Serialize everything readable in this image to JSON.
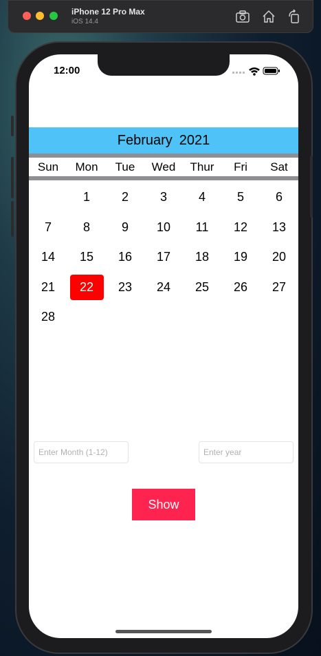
{
  "simulator": {
    "device_name": "iPhone 12 Pro Max",
    "os_version": "iOS 14.4"
  },
  "status_bar": {
    "time": "12:00"
  },
  "calendar": {
    "month": "February",
    "year": "2021",
    "weekdays": [
      "Sun",
      "Mon",
      "Tue",
      "Wed",
      "Thur",
      "Fri",
      "Sat"
    ],
    "days": [
      "",
      "1",
      "2",
      "3",
      "4",
      "5",
      "6",
      "7",
      "8",
      "9",
      "10",
      "11",
      "12",
      "13",
      "14",
      "15",
      "16",
      "17",
      "18",
      "19",
      "20",
      "21",
      "22",
      "23",
      "24",
      "25",
      "26",
      "27",
      "28"
    ],
    "selected_day": "22",
    "header_color": "#4fc3f7",
    "selected_color": "#ff0000"
  },
  "form": {
    "month_placeholder": "Enter Month (1-12)",
    "month_value": "",
    "year_placeholder": "Enter year",
    "year_value": "",
    "show_label": "Show",
    "show_color": "#ff2350"
  }
}
